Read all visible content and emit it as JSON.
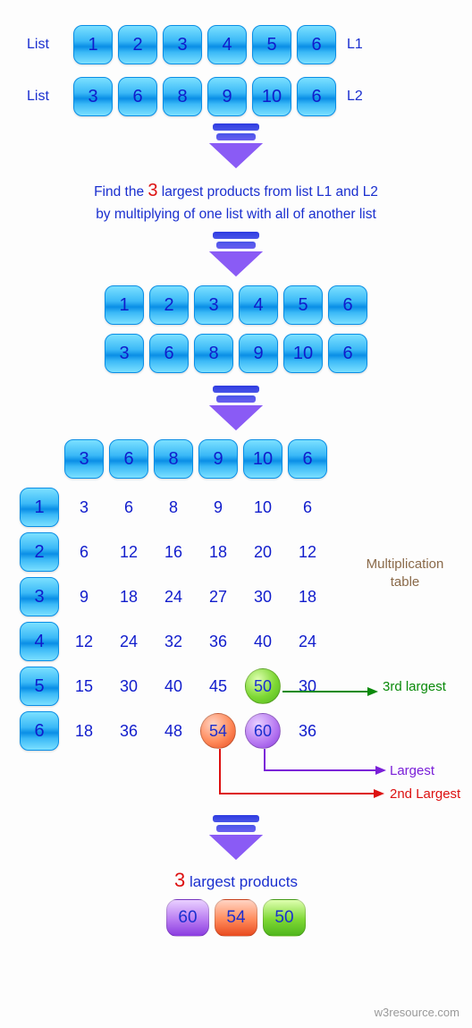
{
  "labels": {
    "list": "List",
    "L1": "L1",
    "L2": "L2",
    "mul_table": "Multiplication table",
    "third": "3rd largest",
    "largest": "Largest",
    "second": "2nd Largest",
    "result_caption_prefix": "3",
    "result_caption_rest": " largest products",
    "footer": "w3resource.com"
  },
  "caption": {
    "pre": "Find the ",
    "num": "3",
    "post1": " largest products from list ",
    "l1": "L1",
    "and": " and ",
    "l2": "L2",
    "line2": "by multiplying of one list with all of another list"
  },
  "chart_data": {
    "type": "table",
    "L1": [
      1,
      2,
      3,
      4,
      5,
      6
    ],
    "L2": [
      3,
      6,
      8,
      9,
      10,
      6
    ],
    "products": [
      [
        3,
        6,
        8,
        9,
        10,
        6
      ],
      [
        6,
        12,
        16,
        18,
        20,
        12
      ],
      [
        9,
        18,
        24,
        27,
        30,
        18
      ],
      [
        12,
        24,
        32,
        36,
        40,
        24
      ],
      [
        15,
        30,
        40,
        45,
        50,
        30
      ],
      [
        18,
        36,
        48,
        54,
        60,
        36
      ]
    ],
    "highlights": {
      "largest": {
        "row": 5,
        "col": 4,
        "value": 60
      },
      "second": {
        "row": 5,
        "col": 3,
        "value": 54
      },
      "third": {
        "row": 4,
        "col": 4,
        "value": 50
      }
    },
    "result": [
      60,
      54,
      50
    ]
  }
}
